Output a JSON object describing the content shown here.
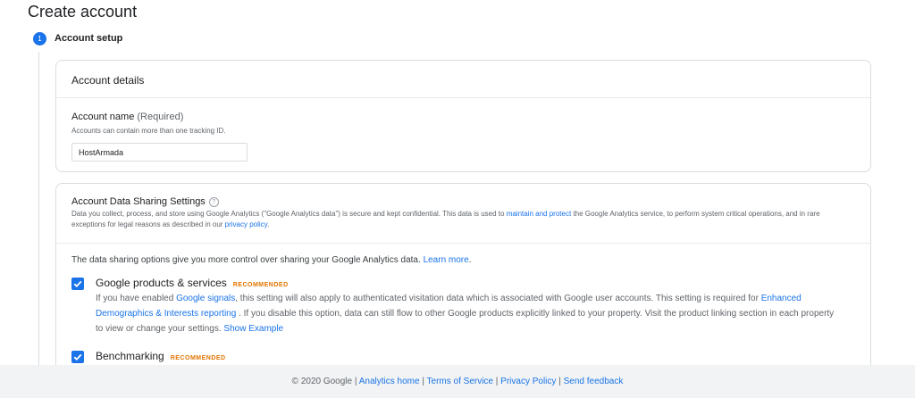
{
  "page": {
    "title": "Create account"
  },
  "stepper": {
    "step_number": "1",
    "step_label": "Account setup"
  },
  "account_details": {
    "header": "Account details",
    "name_label": "Account name",
    "name_required": "(Required)",
    "name_help": "Accounts can contain more than one tracking ID.",
    "name_value": "HostArmada"
  },
  "sharing": {
    "title": "Account Data Sharing Settings",
    "help_icon": "question-circle-icon",
    "desc_1": "Data you collect, process, and store using Google Analytics (\"Google Analytics data\") is secure and kept confidential. This data is used to ",
    "desc_link_1": "maintain and protect",
    "desc_2": " the Google Analytics service, to perform system critical operations, and in rare exceptions for legal reasons as described in our ",
    "desc_link_2": "privacy policy",
    "desc_3": ".",
    "intro": "The data sharing options give you more control over sharing your Google Analytics data.",
    "learn_more": "Learn more",
    "intro_end": ".",
    "options": [
      {
        "title": "Google products & services",
        "badge": "RECOMMENDED",
        "checked": true,
        "desc_1": "If you have enabled ",
        "link_1": "Google signals",
        "desc_2": ", this setting will also apply to authenticated visitation data which is associated with Google user accounts. This setting is required for ",
        "link_2": "Enhanced Demographics & Interests reporting",
        "desc_3": " . If you disable this option, data can still flow to other Google products explicitly linked to your property. Visit the product linking section in each property to view or change your settings. ",
        "link_3": "Show Example"
      },
      {
        "title": "Benchmarking",
        "badge": "RECOMMENDED",
        "checked": true
      }
    ]
  },
  "footer": {
    "copyright": "© 2020 Google",
    "sep": "|",
    "links": [
      "Analytics home",
      "Terms of Service",
      "Privacy Policy",
      "Send feedback"
    ]
  },
  "colors": {
    "accent": "#1a73e8",
    "badge": "#e37400",
    "footer_bg": "#f1f3f4"
  }
}
